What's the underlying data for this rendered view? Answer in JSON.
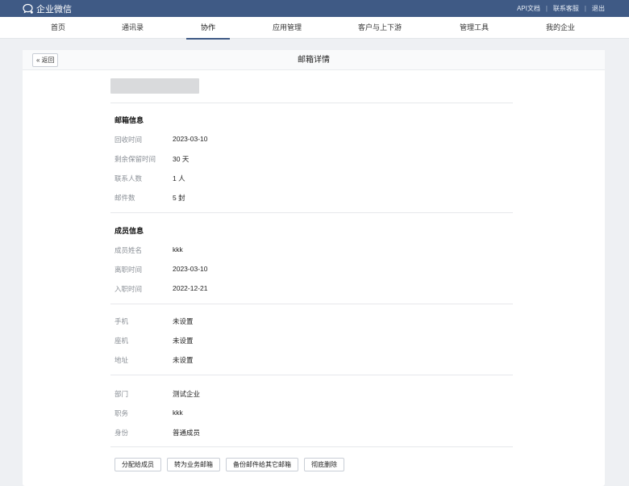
{
  "topbar": {
    "brand": "企业微信",
    "links": [
      "API文档",
      "联系客服",
      "退出"
    ]
  },
  "nav": {
    "items": [
      {
        "label": "首页"
      },
      {
        "label": "通讯录"
      },
      {
        "label": "协作",
        "active": true
      },
      {
        "label": "应用管理"
      },
      {
        "label": "客户与上下游"
      },
      {
        "label": "管理工具"
      },
      {
        "label": "我的企业"
      }
    ]
  },
  "card": {
    "back_label": "返回",
    "title": "邮箱详情"
  },
  "mailbox_info": {
    "title": "邮箱信息",
    "rows": [
      {
        "label": "回收时间",
        "value": "2023-03-10"
      },
      {
        "label": "剩余保留时间",
        "value": "30 天"
      },
      {
        "label": "联系人数",
        "value": "1 人"
      },
      {
        "label": "邮件数",
        "value": "5 封"
      }
    ]
  },
  "member_info": {
    "title": "成员信息",
    "rows": [
      {
        "label": "成员姓名",
        "value": "kkk"
      },
      {
        "label": "离职时间",
        "value": "2023-03-10"
      },
      {
        "label": "入职时间",
        "value": "2022-12-21"
      }
    ]
  },
  "contact_info": {
    "rows": [
      {
        "label": "手机",
        "value": "未设置"
      },
      {
        "label": "座机",
        "value": "未设置"
      },
      {
        "label": "地址",
        "value": "未设置"
      }
    ]
  },
  "org_info": {
    "rows": [
      {
        "label": "部门",
        "value": "测试企业"
      },
      {
        "label": "职务",
        "value": "kkk"
      },
      {
        "label": "身份",
        "value": "普通成员"
      }
    ]
  },
  "actions": [
    "分配给成员",
    "转为业务邮箱",
    "备份邮件给其它邮箱",
    "彻底删除"
  ],
  "colors": {
    "topbar": "#3f5a85",
    "page_bg": "#eef0f3",
    "label_gray": "#8a8f96"
  }
}
